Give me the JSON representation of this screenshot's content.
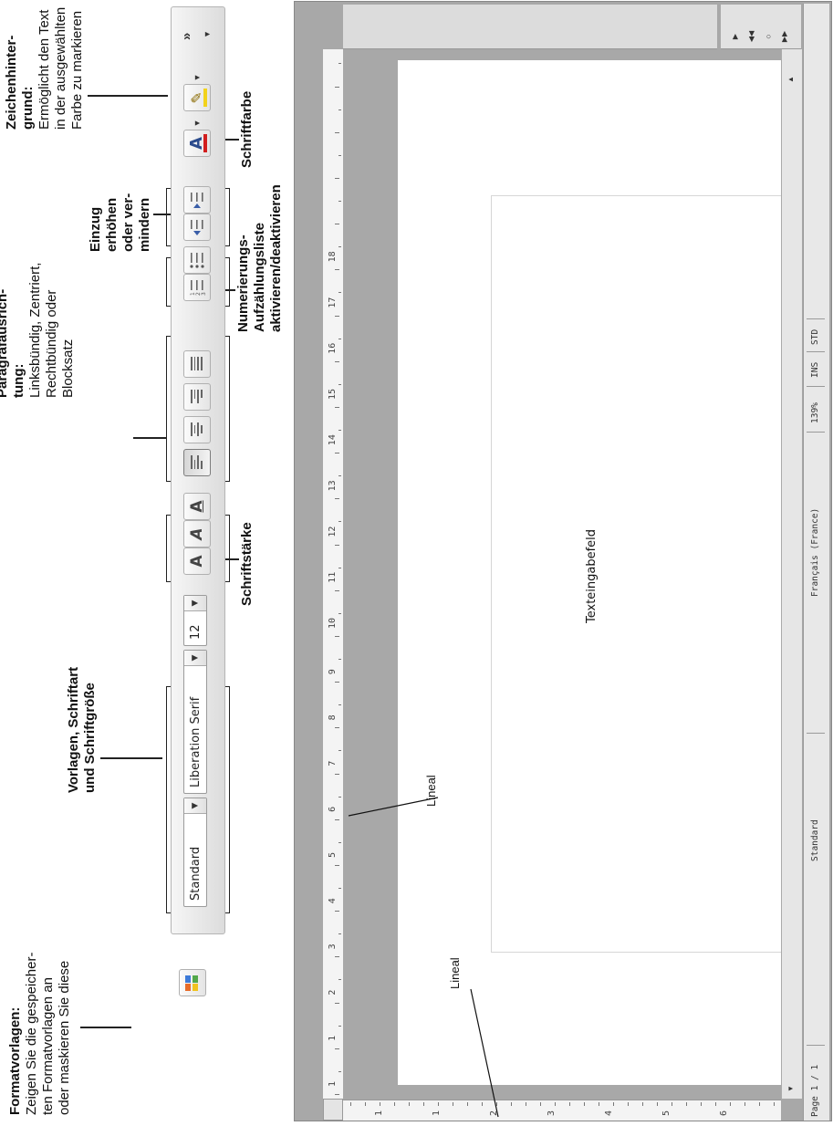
{
  "annotations": {
    "formatvorlagen": {
      "title": "Formatvorlagen:",
      "lines": [
        "Zeigen Sie die gespeicher-",
        "ten Formatvorlagen an",
        "oder maskieren Sie diese"
      ]
    },
    "vorlagen": {
      "lines": [
        "Vorlagen, Schriftart",
        "und Schriftgröße"
      ]
    },
    "schriftstaerke": {
      "label": "Schriftstärke"
    },
    "paragraph": {
      "title_lines": [
        "Paragrafausrich-",
        "tung:"
      ],
      "lines": [
        "Linksbündig, Zentriert,",
        "Rechtbündig oder",
        "Blocksatz"
      ]
    },
    "numerierung": {
      "lines": [
        "Numerierungs-",
        "Aufzählungsliste",
        "aktivieren/deaktivieren"
      ]
    },
    "einzug": {
      "lines": [
        "Einzug",
        "erhöhen",
        "oder ver-",
        "mindern"
      ]
    },
    "schriftfarbe": {
      "label": "Schriftfarbe"
    },
    "zeichenhintergrund": {
      "title_lines": [
        "Zeichenhinter-",
        "grund:"
      ],
      "lines": [
        "Ermöglicht den Text",
        "in der ausgewählten",
        "Farbe zu markieren"
      ]
    },
    "lineal_top": "Lineal",
    "lineal_left": "Lineal",
    "texteingabefeld": "Texteingabefeld"
  },
  "toolbar": {
    "style_value": "Standard",
    "font_value": "Liberation Serif",
    "size_value": "12",
    "dropdown_glyph": "▼",
    "overflow_glyph": "»",
    "bold_glyph": "A",
    "italic_glyph": "A",
    "underline_glyph": "A",
    "font_color_glyph": "A",
    "highlight_glyph": "✎"
  },
  "ruler": {
    "top_labels": [
      "1",
      "1",
      "2",
      "3",
      "4",
      "5",
      "6",
      "7",
      "8",
      "9",
      "10",
      "11",
      "12",
      "13",
      "14",
      "15",
      "16",
      "17",
      "18"
    ],
    "left_labels": [
      "1",
      "1",
      "2",
      "3",
      "4",
      "5",
      "6"
    ]
  },
  "statusbar": {
    "page": "Page 1 / 1",
    "style": "Standard",
    "language": "Français (France)",
    "zoom": "139%",
    "insert_mode": "INS",
    "selection_mode": "STD"
  },
  "nav": {
    "up": "▲",
    "down": "▼",
    "next": "▶",
    "prev": "◀◀",
    "nav": "○",
    "last": "▶▶"
  },
  "colors": {
    "canvas_gray": "#a8a8a8",
    "page_white": "#ffffff",
    "toolbar_bg": "#e8e8e8",
    "font_color_red": "#d21e1e",
    "highlight_yellow": "#f2d21b"
  }
}
